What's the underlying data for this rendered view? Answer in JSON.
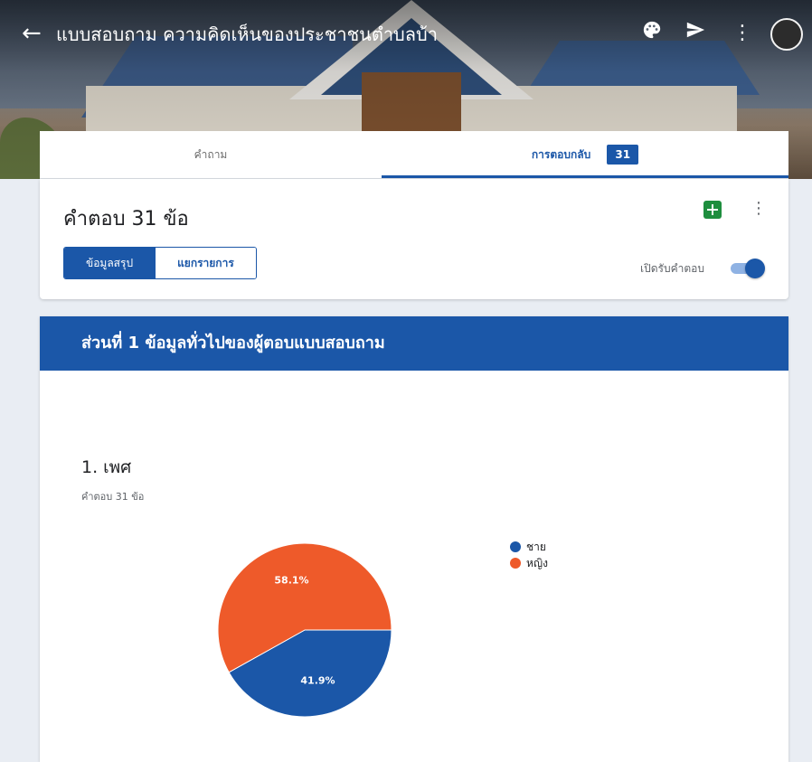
{
  "header": {
    "title": "แบบสอบถาม ความคิดเห็นของประชาชนตำบลบ้า",
    "icons": [
      "back-arrow-icon",
      "palette-icon",
      "send-icon",
      "more-vert-icon",
      "avatar"
    ]
  },
  "tabs": {
    "questions_label": "คำถาม",
    "responses_label": "การตอบกลับ",
    "responses_badge": "31"
  },
  "responses": {
    "count_label": "คำตอบ 31 ข้อ",
    "summary_label": "ข้อมูลสรุป",
    "individual_label": "แยกรายการ",
    "accepting_label": "เปิดรับคำตอบ",
    "accepting_on": true
  },
  "section": {
    "title": "ส่วนที่ 1 ข้อมูลทั่วไปของผู้ตอบแบบสอบถาม"
  },
  "question": {
    "title": "1. เพศ",
    "count_label": "คำตอบ 31 ข้อ"
  },
  "colors": {
    "accent": "#1b57a8",
    "male": "#1b57a8",
    "female": "#ee5a2a",
    "sheets_green": "#1e8e3e"
  },
  "chart_data": {
    "type": "pie",
    "categories": [
      "ชาย",
      "หญิง"
    ],
    "values": [
      41.9,
      58.1
    ],
    "labels": [
      "41.9%",
      "58.1%"
    ],
    "colors": [
      "#1b57a8",
      "#ee5a2a"
    ],
    "legend_position": "right"
  }
}
